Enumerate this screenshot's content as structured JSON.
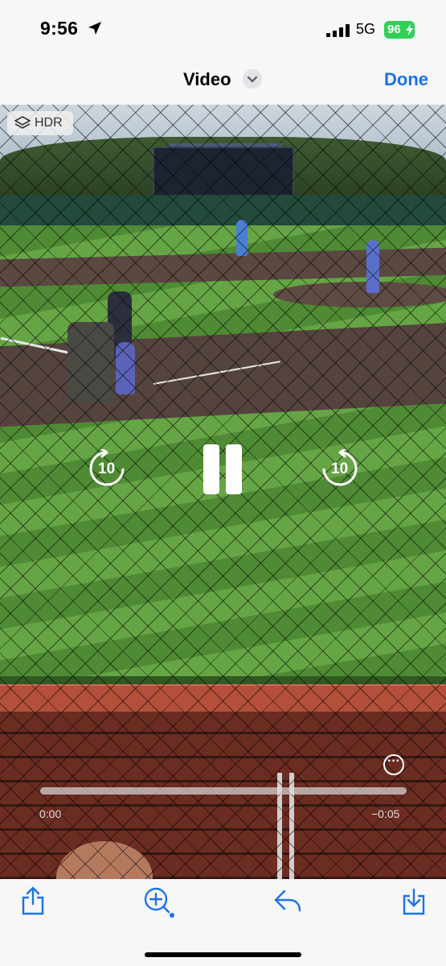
{
  "status_bar": {
    "time": "9:56",
    "network": "5G",
    "battery": "96"
  },
  "nav": {
    "title": "Video",
    "done_label": "Done"
  },
  "video": {
    "hdr_label": "HDR",
    "skip_back_label": "10",
    "skip_forward_label": "10",
    "elapsed": "0:00",
    "remaining": "−0:05",
    "progress": 0
  },
  "toolbar": {
    "icons": [
      "share-icon",
      "zoom-icon",
      "reply-icon",
      "save-icon"
    ]
  },
  "colors": {
    "accent": "#1a73e8",
    "battery": "#30d158"
  }
}
